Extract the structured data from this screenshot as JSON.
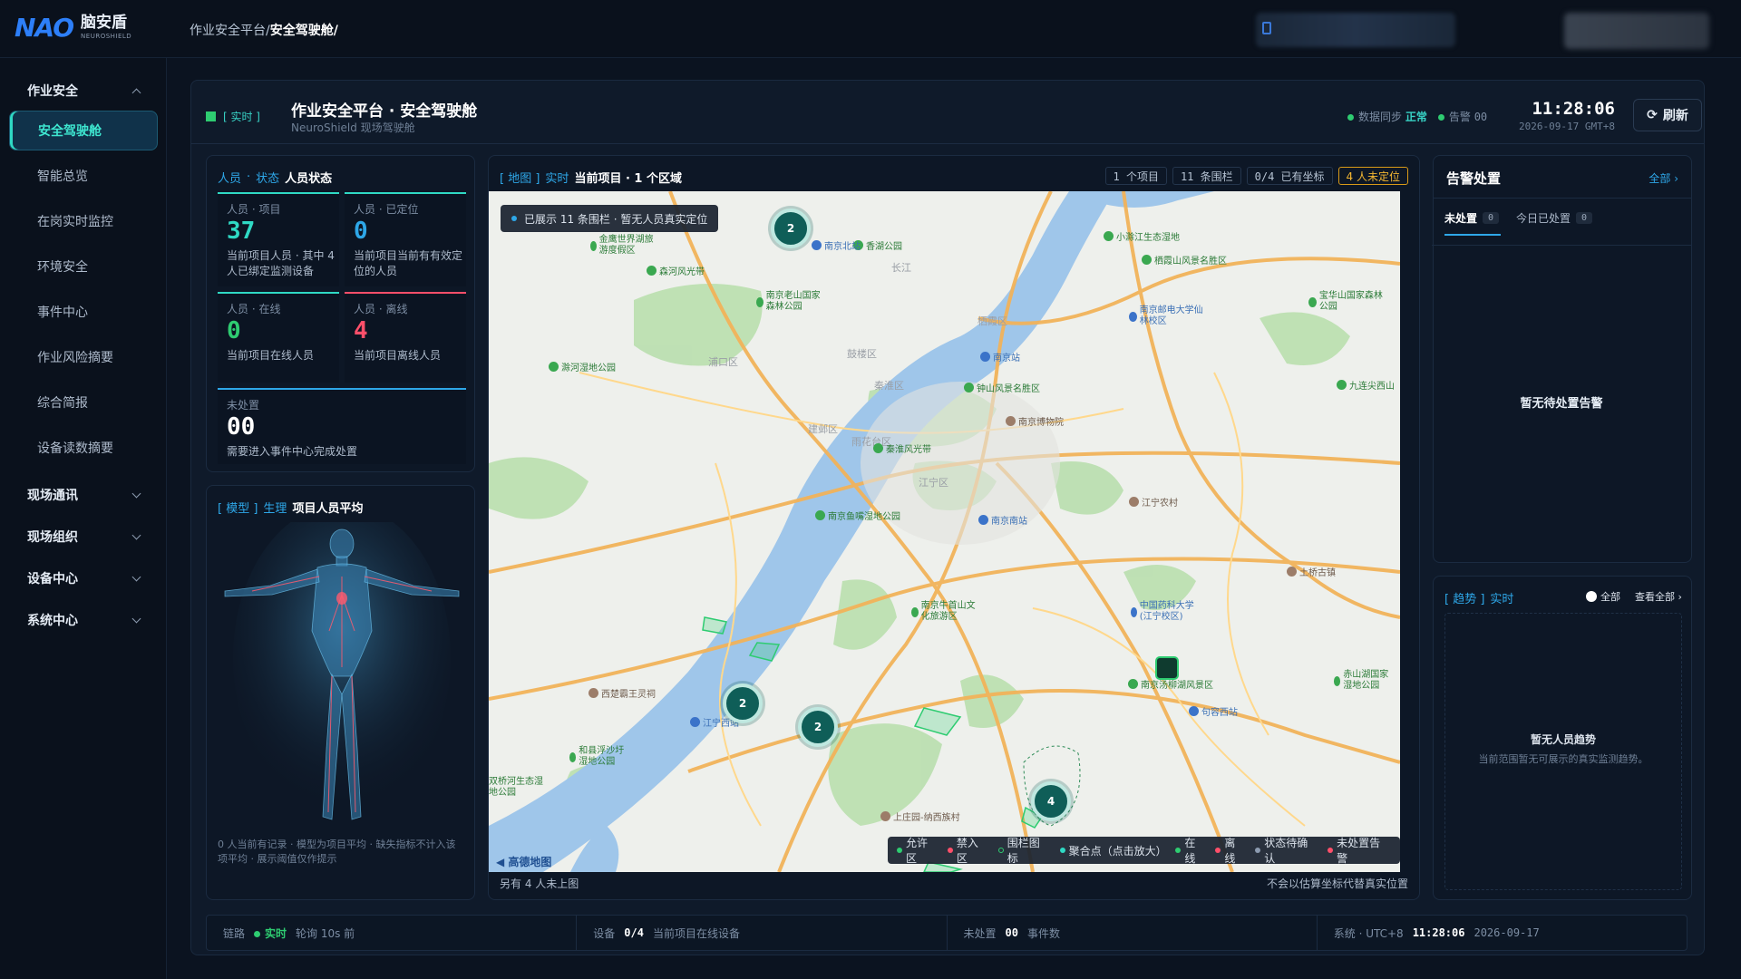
{
  "brand": {
    "logo": "NAO",
    "name_cn": "脑安盾",
    "name_en": "NEUROSHIELD"
  },
  "breadcrumb": {
    "parent": "作业安全平台/",
    "current": "安全驾驶舱/"
  },
  "sidebar": {
    "groups": [
      {
        "label": "作业安全",
        "expanded": true
      },
      {
        "label": "现场通讯",
        "expanded": false
      },
      {
        "label": "现场组织",
        "expanded": false
      },
      {
        "label": "设备中心",
        "expanded": false
      },
      {
        "label": "系统中心",
        "expanded": false
      }
    ],
    "items": [
      "安全驾驶舱",
      "智能总览",
      "在岗实时监控",
      "环境安全",
      "事件中心",
      "作业风险摘要",
      "综合简报",
      "设备读数摘要"
    ],
    "active_item": "安全驾驶舱"
  },
  "header": {
    "live_tag": "[ 实时 ]",
    "title": "作业安全平台 · 安全驾驶舱",
    "subtitle": "NeuroShield 现场驾驶舱",
    "sync_label": "数据同步",
    "sync_value": "正常",
    "alert_label": "告警",
    "alert_value": "00",
    "time": "11:28:06",
    "date": "2026-09-17 GMT+8",
    "refresh_label": "刷新"
  },
  "people_panel": {
    "title_key1": "人员",
    "title_key2": "状态",
    "title": "人员状态",
    "cards": [
      {
        "label": "人员 · 项目",
        "value": "37",
        "desc": "当前项目人员 · 其中 4 人已绑定监测设备",
        "color": "#2fd9c4"
      },
      {
        "label": "人员 · 已定位",
        "value": "0",
        "desc": "当前项目当前有有效定位的人员",
        "color": "#2ea7e8"
      },
      {
        "label": "人员 · 在线",
        "value": "0",
        "desc": "当前项目在线人员",
        "color": "#2ecc71"
      },
      {
        "label": "人员 · 离线",
        "value": "4",
        "desc": "当前项目离线人员",
        "color": "#ff4f6a"
      }
    ],
    "pending": {
      "label": "未处置",
      "value": "00",
      "desc": "需要进入事件中心完成处置"
    }
  },
  "model_panel": {
    "key1": "[ 模型 ]",
    "key2": "生理",
    "title": "项目人员平均",
    "note": "0 人当前有记录 · 模型为项目平均 · 缺失指标不计入该项平均 · 展示阈值仅作提示"
  },
  "map_panel": {
    "key1": "[ 地图 ]",
    "key2": "实时",
    "title": "当前项目 · 1 个区域",
    "chips": [
      "1 个项目",
      "11 条围栏",
      "0/4 已有坐标",
      "4 人未定位"
    ],
    "info": "已展示 11 条围栏 · 暂无人员真实定位",
    "clusters": [
      "2",
      "2",
      "2",
      "4"
    ],
    "legend": [
      "允许区",
      "禁入区",
      "围栏图标",
      "聚合点（点击放大）",
      "在线",
      "离线",
      "状态待确认",
      "未处置告警"
    ],
    "legend_colors": [
      "#2ecc71",
      "#ff4f6a",
      "#2ecc71",
      "#2fd9c4",
      "#2ecc71",
      "#ff4f6a",
      "#8c9bb0",
      "#ff4f6a"
    ],
    "map_brand": "高德地图",
    "footer_left": "另有 4 人未上图",
    "footer_right": "不会以估算坐标代替真实位置",
    "places": {
      "green": [
        "金鹰世界湖旅游度假区",
        "森河风光带",
        "南京老山国家森林公园",
        "滁河湿地公园",
        "南京鱼嘴湿地公园",
        "南京牛首山文化旅游区",
        "和县浮沙圩湿地公园",
        "钟山风景名胜区",
        "秦淮风光带",
        "小滁江生态湿地",
        "栖霞山风景名胜区",
        "宝华山国家森林公园",
        "九连尖西山",
        "赤山湖国家湿地公园",
        "南京汤柳湖风景区",
        "双桥河生态湿地公园",
        "香湖公园"
      ],
      "blue": [
        "南京北站",
        "南京站",
        "南京南站",
        "南京邮电大学仙林校区",
        "中国药科大学(江宁校区)",
        "句容西站",
        "江宁西站"
      ],
      "brown": [
        "南京博物院",
        "江宁农村",
        "土桥古镇",
        "西楚霸王灵祠",
        "上庄园-纳西族村"
      ],
      "districts": [
        "浦口区",
        "鼓楼区",
        "秦淮区",
        "建邺区",
        "雨花台区",
        "江宁区",
        "栖霞区",
        "长江"
      ]
    }
  },
  "alert_panel": {
    "title": "告警处置",
    "all_link": "全部",
    "tab_pending": "未处置",
    "tab_pending_count": "0",
    "tab_today": "今日已处置",
    "tab_today_count": "0",
    "empty": "暂无待处置告警"
  },
  "trend_panel": {
    "key1": "[ 趋势 ]",
    "key2": "实时",
    "toggle_label": "全部",
    "view_all": "查看全部",
    "empty_title": "暂无人员趋势",
    "empty_desc": "当前范围暂无可展示的真实监测趋势。"
  },
  "footer": {
    "link_label": "链路",
    "link_status": "实时",
    "link_poll": "轮询 10s 前",
    "device_label": "设备",
    "device_value": "0/4",
    "device_desc": "当前项目在线设备",
    "pending_label": "未处置",
    "pending_value": "00",
    "pending_desc": "事件数",
    "sys_label": "系统 · UTC+8",
    "sys_time": "11:28:06",
    "sys_date": "2026-09-17"
  }
}
